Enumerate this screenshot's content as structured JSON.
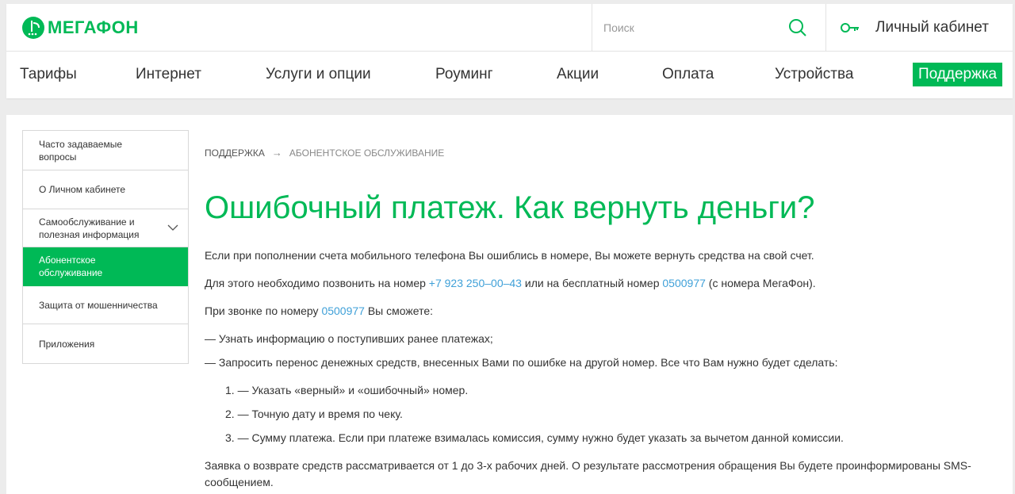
{
  "header": {
    "logo_text": "МЕГАФОН",
    "search_placeholder": "Поиск",
    "cabinet_label": "Личный кабинет"
  },
  "nav": {
    "items": [
      {
        "label": "Тарифы"
      },
      {
        "label": "Интернет"
      },
      {
        "label": "Услуги и опции"
      },
      {
        "label": "Роуминг"
      },
      {
        "label": "Акции"
      },
      {
        "label": "Оплата"
      },
      {
        "label": "Устройства"
      },
      {
        "label": "Поддержка",
        "active": true
      }
    ]
  },
  "sidebar": {
    "items": [
      {
        "label": "Часто задаваемые вопросы"
      },
      {
        "label": "О Личном кабинете"
      },
      {
        "label": "Самообслуживание и полезная информация",
        "expandable": true
      },
      {
        "label": "Абонентское обслуживание",
        "active": true
      },
      {
        "label": "Защита от мошенничества"
      },
      {
        "label": "Приложения"
      }
    ]
  },
  "breadcrumb": {
    "first": "ПОДДЕРЖКА",
    "arrow": "→",
    "second": "АБОНЕНТСКОЕ ОБСЛУЖИВАНИЕ"
  },
  "article": {
    "title": "Ошибочный платеж. Как вернуть деньги?",
    "p1": "Если при пополнении счета мобильного телефона Вы ошиблись в номере, Вы можете вернуть средства на свой счет.",
    "p2_before": "Для этого необходимо позвонить на номер ",
    "p2_phone1": "+7 923 250–00–43",
    "p2_middle": " или на бесплатный номер ",
    "p2_phone2": "0500977",
    "p2_after": " (с номера МегаФон).",
    "p3_before": "При звонке по номеру ",
    "p3_phone": "0500977",
    "p3_after": " Вы сможете:",
    "dash1": "—  Узнать информацию о поступивших ранее платежах;",
    "dash2": "—  Запросить перенос денежных средств, внесенных Вами по ошибке на другой номер. Все что Вам нужно будет сделать:",
    "num1": "1. —   Указать «верный» и «ошибочный» номер.",
    "num2": "2. —   Точную дату и время по чеку.",
    "num3": "3. —   Сумму платежа. Если при платеже взималась комиссия, сумму нужно будет указать за вычетом данной комиссии.",
    "p4": "Заявка о возврате средств рассматривается от 1 до 3-х рабочих дней. О результате рассмотрения обращения Вы будете проинформированы SMS-сообщением."
  },
  "colors": {
    "brand_green": "#00b956",
    "link_blue": "#3fa0d8",
    "logo_purple": "#731982"
  }
}
